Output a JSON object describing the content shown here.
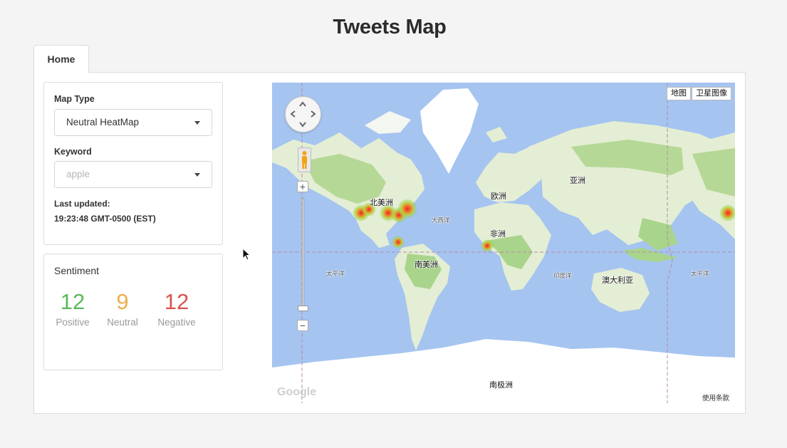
{
  "page": {
    "title": "Tweets Map"
  },
  "tabs": [
    {
      "label": "Home"
    }
  ],
  "controls": {
    "map_type": {
      "label": "Map Type",
      "value": "Neutral HeatMap"
    },
    "keyword": {
      "label": "Keyword",
      "placeholder": "apple"
    },
    "last_updated": {
      "label": "Last updated:",
      "value": "19:23:48 GMT-0500 (EST)"
    }
  },
  "sentiment": {
    "title": "Sentiment",
    "positive": {
      "count": "12",
      "label": "Positive",
      "color": "#5cb85c"
    },
    "neutral": {
      "count": "9",
      "label": "Neutral",
      "color": "#f0ad4e"
    },
    "negative": {
      "count": "12",
      "label": "Negative",
      "color": "#d9534f"
    }
  },
  "map": {
    "type_buttons": [
      "地图",
      "卫星图像"
    ],
    "labels": {
      "north_america": "北美洲",
      "south_america": "南美洲",
      "europe": "欧洲",
      "asia": "亚洲",
      "africa": "非洲",
      "australia": "澳大利亚",
      "antarctica": "南极洲",
      "atlantic": "大西洋",
      "pacific_left": "太平洋",
      "pacific_right": "太平洋",
      "indian": "印度洋"
    },
    "zoom_in": "+",
    "zoom_out": "−",
    "logo": "Google",
    "terms": "使用条款",
    "colors": {
      "ocean": "#a5c4f0",
      "land": "#e4eed4",
      "forest": "#a9d48c",
      "ice": "#ffffff"
    }
  }
}
